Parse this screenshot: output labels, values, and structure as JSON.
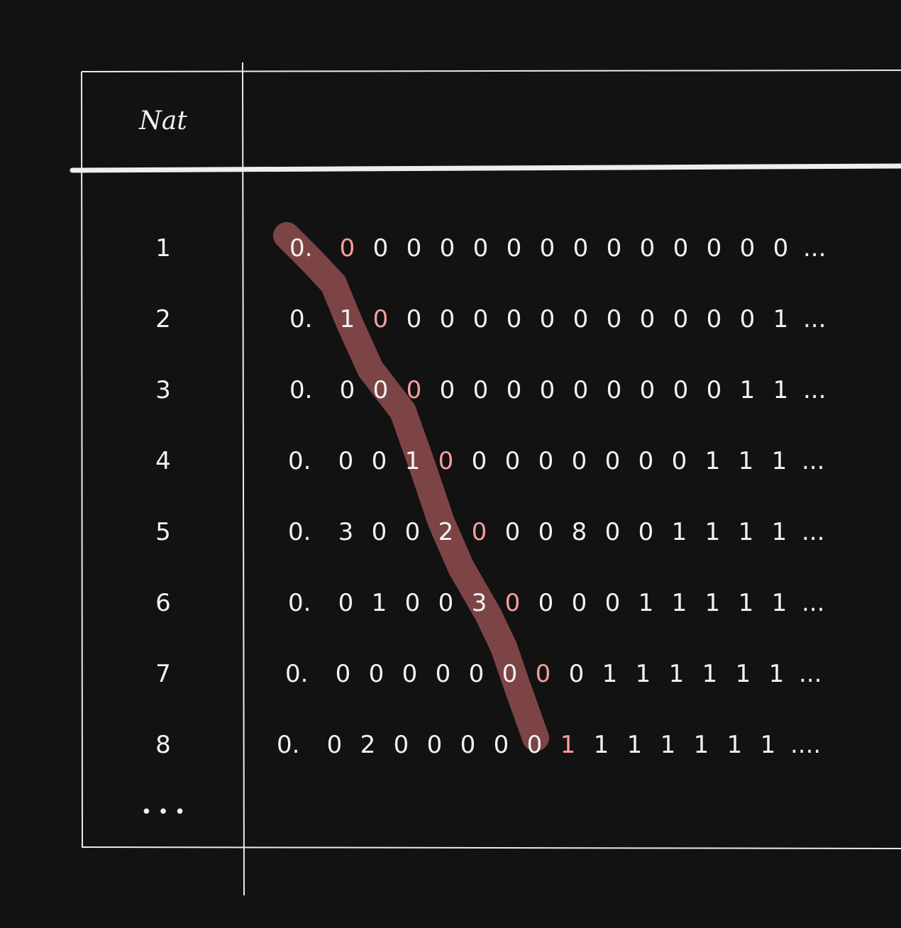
{
  "table": {
    "header": "Nat",
    "nat_ellipsis": "• • •",
    "rows": [
      {
        "n": "1",
        "prefix": "0.",
        "digits": [
          "0",
          "0",
          "0",
          "0",
          "0",
          "0",
          "0",
          "0",
          "0",
          "0",
          "0",
          "0",
          "0",
          "0"
        ],
        "tail": "..."
      },
      {
        "n": "2",
        "prefix": "0.",
        "digits": [
          "1",
          "0",
          "0",
          "0",
          "0",
          "0",
          "0",
          "0",
          "0",
          "0",
          "0",
          "0",
          "0",
          "1"
        ],
        "tail": "..."
      },
      {
        "n": "3",
        "prefix": "0.",
        "digits": [
          "0",
          "0",
          "0",
          "0",
          "0",
          "0",
          "0",
          "0",
          "0",
          "0",
          "0",
          "0",
          "1",
          "1"
        ],
        "tail": "..."
      },
      {
        "n": "4",
        "prefix": "0.",
        "digits": [
          "0",
          "0",
          "1",
          "0",
          "0",
          "0",
          "0",
          "0",
          "0",
          "0",
          "0",
          "1",
          "1",
          "1"
        ],
        "tail": "..."
      },
      {
        "n": "5",
        "prefix": "0.",
        "digits": [
          "3",
          "0",
          "0",
          "2",
          "0",
          "0",
          "0",
          "8",
          "0",
          "0",
          "1",
          "1",
          "1",
          "1"
        ],
        "tail": "..."
      },
      {
        "n": "6",
        "prefix": "0.",
        "digits": [
          "0",
          "1",
          "0",
          "0",
          "3",
          "0",
          "0",
          "0",
          "0",
          "1",
          "1",
          "1",
          "1",
          "1"
        ],
        "tail": "..."
      },
      {
        "n": "7",
        "prefix": "0.",
        "digits": [
          "0",
          "0",
          "0",
          "0",
          "0",
          "0",
          "0",
          "0",
          "1",
          "1",
          "1",
          "1",
          "1",
          "1"
        ],
        "tail": "..."
      },
      {
        "n": "8",
        "prefix": "0.",
        "digits": [
          "0",
          "2",
          "0",
          "0",
          "0",
          "0",
          "0",
          "1",
          "1",
          "1",
          "1",
          "1",
          "1",
          "1"
        ],
        "tail": "...."
      }
    ]
  },
  "colors": {
    "background": "#121212",
    "line": "#f2f2f2",
    "diagonal_stroke": "#7d4445",
    "highlight_digit": "#ff9d9d"
  }
}
